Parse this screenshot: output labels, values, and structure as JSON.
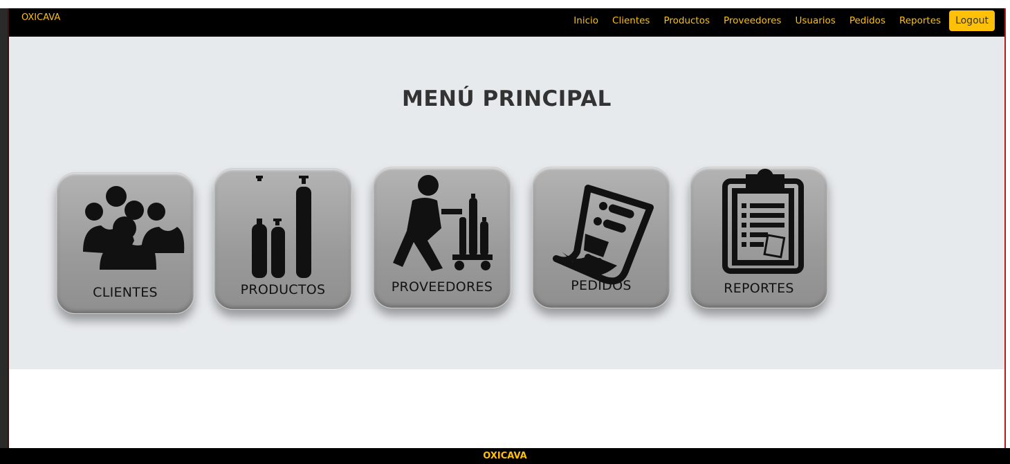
{
  "brand": "OXICAVA",
  "nav": {
    "links": [
      "Inicio",
      "Clientes",
      "Productos",
      "Proveedores",
      "Usuarios",
      "Pedidos",
      "Reportes"
    ],
    "logout": "Logout"
  },
  "page_title": "MENÚ PRINCIPAL",
  "tiles": [
    {
      "label": "CLIENTES",
      "icon": "users-group-icon"
    },
    {
      "label": "PRODUCTOS",
      "icon": "gas-cylinders-icon"
    },
    {
      "label": "PROVEEDORES",
      "icon": "delivery-worker-icon"
    },
    {
      "label": "PEDIDOS",
      "icon": "order-receipt-icon"
    },
    {
      "label": "REPORTES",
      "icon": "clipboard-report-icon"
    }
  ],
  "footer": "OXICAVA",
  "colors": {
    "accent": "#ffc107",
    "navbar": "#000000",
    "main_bg": "#e7eaed",
    "tile": "#9e9e9e"
  }
}
